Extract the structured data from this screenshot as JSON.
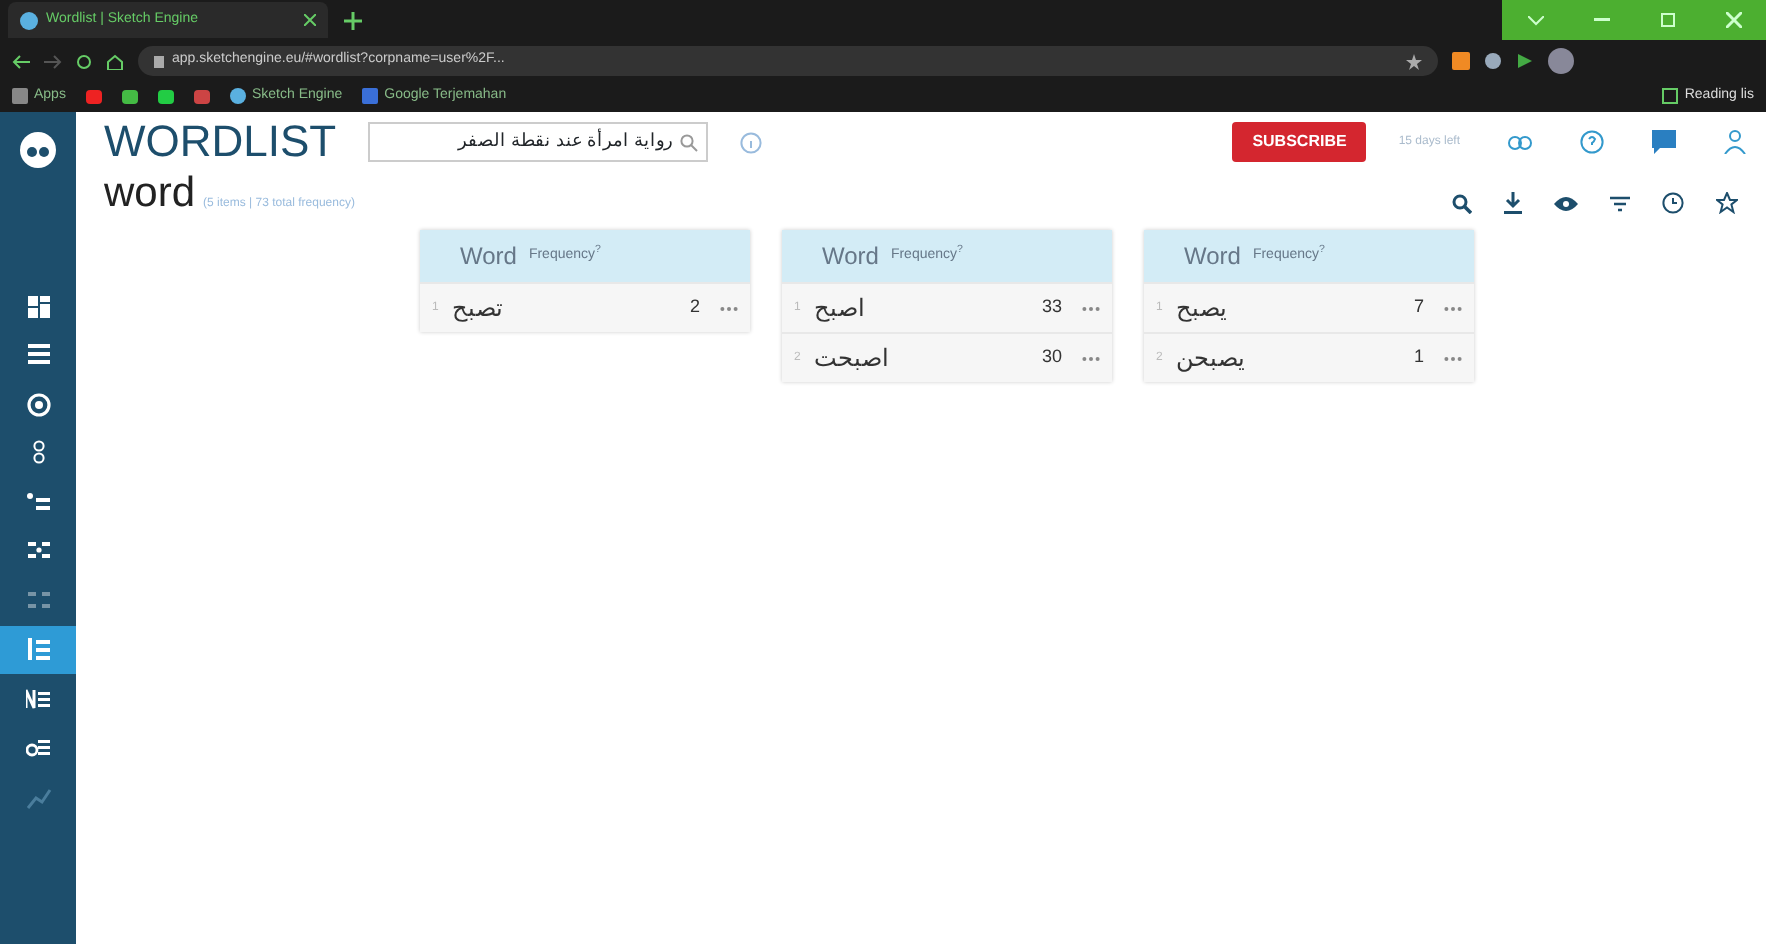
{
  "browser": {
    "tab_title": "Wordlist | Sketch Engine",
    "url": "app.sketchengine.eu/#wordlist?corpname=user%2F...",
    "bookmarks": [
      "Apps",
      "Sketch Engine",
      "Google Terjemahan"
    ],
    "reading_list": "Reading lis"
  },
  "sidebar": {
    "items": [
      {
        "selected": false
      },
      {
        "selected": false
      },
      {
        "selected": false
      },
      {
        "selected": false
      },
      {
        "selected": false
      },
      {
        "selected": false
      },
      {
        "selected": false
      },
      {
        "selected": true
      },
      {
        "selected": false
      },
      {
        "selected": false
      },
      {
        "selected": false
      }
    ]
  },
  "header": {
    "title": "WORDLIST",
    "search": "رواية امرأة عند نقطة الصفر",
    "subscribe": "SUBSCRIBE",
    "trial": "15 days left"
  },
  "result": {
    "title": "word",
    "summary": "(5 items | 73 total frequency)"
  },
  "tables": [
    {
      "columns": [
        "Word",
        "Frequency$^{?}$"
      ],
      "rows": [
        {
          "num": "1",
          "word": "تصبح",
          "freq": "2"
        }
      ]
    },
    {
      "columns": [
        "Word",
        "Frequency$^{?}$"
      ],
      "rows": [
        {
          "num": "1",
          "word": "اصبح",
          "freq": "33"
        },
        {
          "num": "2",
          "word": "اصبحت",
          "freq": "30"
        }
      ]
    },
    {
      "columns": [
        "Word",
        "Frequency$^{?}$"
      ],
      "rows": [
        {
          "num": "1",
          "word": "يصبح",
          "freq": "7"
        },
        {
          "num": "2",
          "word": "يصبحن",
          "freq": "1"
        }
      ]
    }
  ]
}
